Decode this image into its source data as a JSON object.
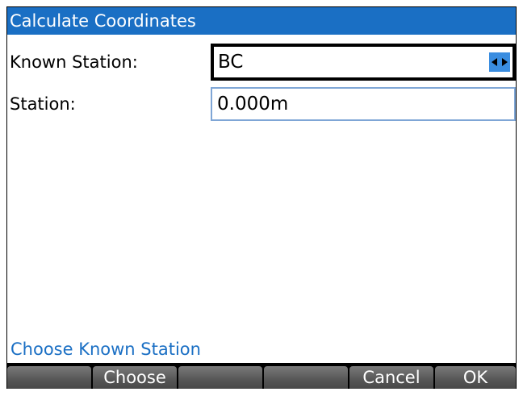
{
  "window": {
    "title": "Calculate Coordinates"
  },
  "form": {
    "known_station_label": "Known Station:",
    "known_station_value": "BC",
    "station_label": "Station:",
    "station_value": "0.000m"
  },
  "status": {
    "text": "Choose Known Station"
  },
  "softkeys": [
    "",
    "Choose",
    "",
    "",
    "Cancel",
    "OK"
  ],
  "icons": {
    "chooser_arrows": "left-right-arrows-icon"
  },
  "colors": {
    "titlebar": "#1a6fc4",
    "status_text": "#1a6fc4",
    "chooser_arrow_bg": "#3a8de0"
  }
}
